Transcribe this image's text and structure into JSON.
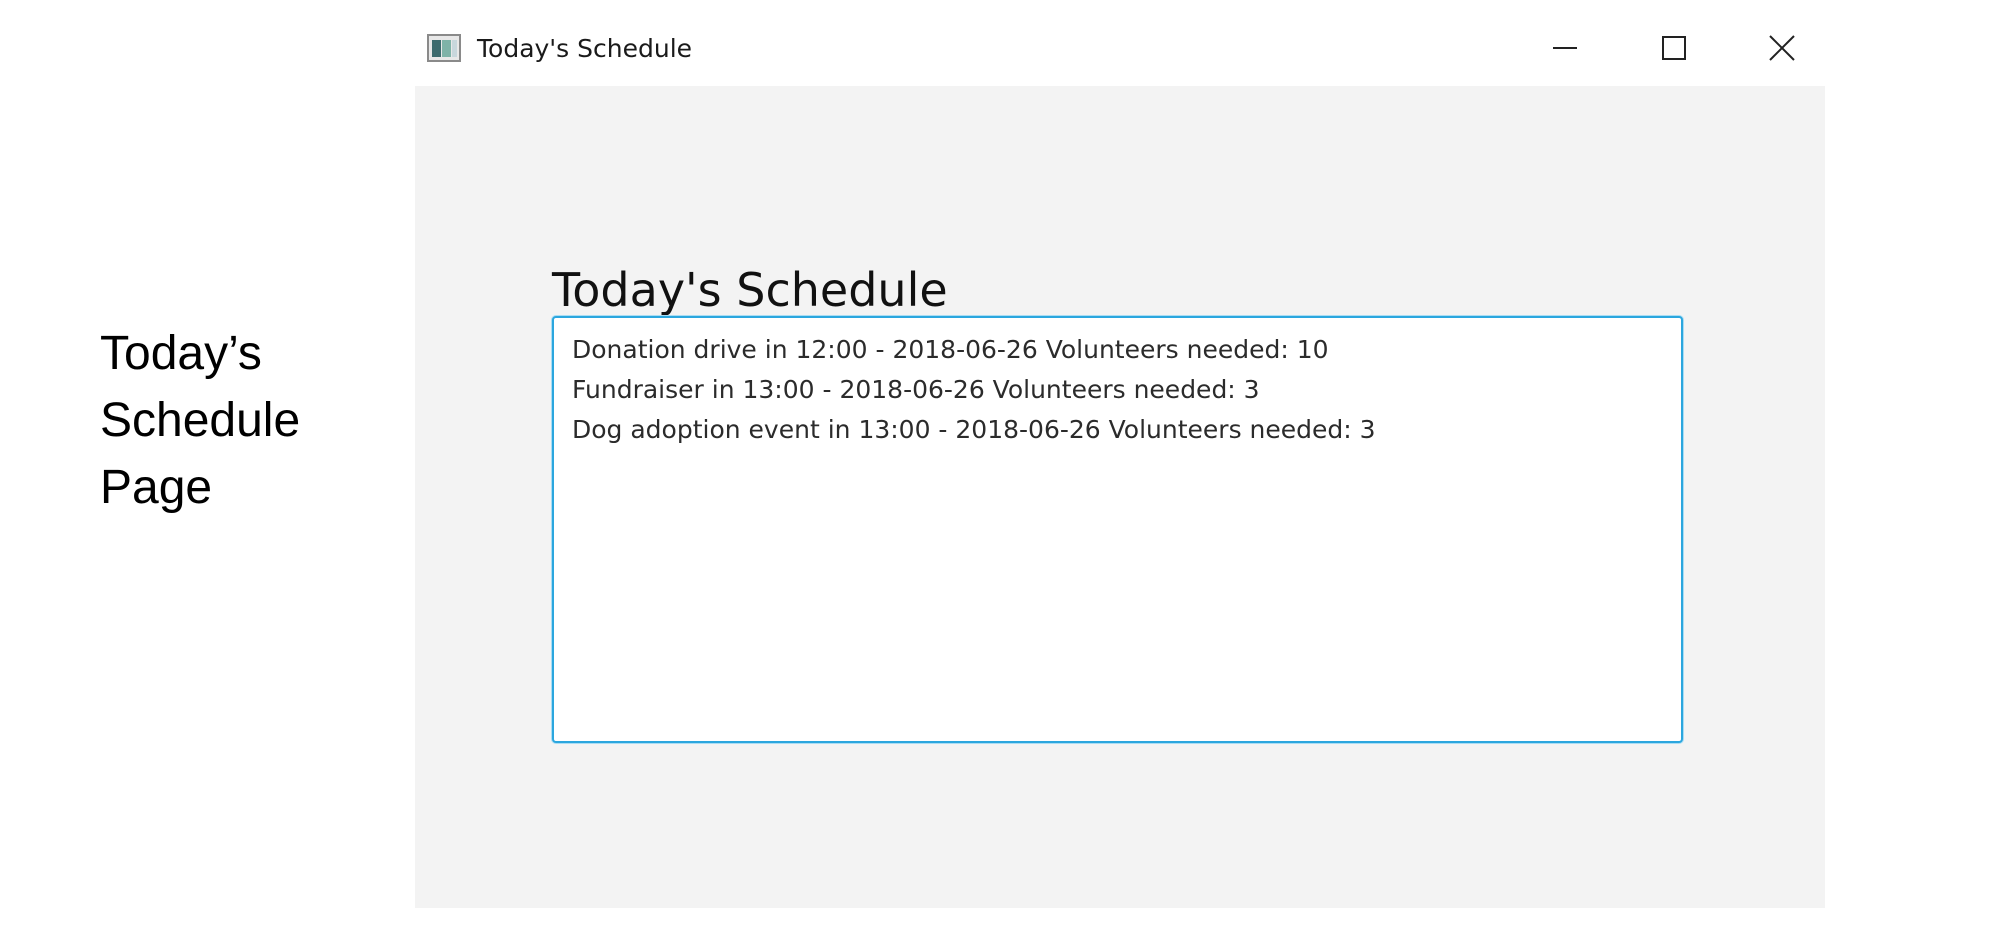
{
  "caption": {
    "lines": [
      "Today’s",
      "Schedule",
      "Page"
    ]
  },
  "window": {
    "title": "Today's Schedule",
    "icon": "app-window-icon",
    "controls": {
      "minimize_icon": "minimize-icon",
      "maximize_icon": "maximize-icon",
      "close_icon": "close-icon"
    }
  },
  "main": {
    "heading": "Today's Schedule",
    "list_items": [
      "Donation drive in 12:00 - 2018-06-26 Volunteers needed: 10",
      "Fundraiser in 13:00 - 2018-06-26 Volunteers needed: 3",
      "Dog adoption event in 13:00 - 2018-06-26 Volunteers needed: 3"
    ]
  },
  "colors": {
    "client_background": "#f3f3f3",
    "focus_border": "#2ba6de",
    "list_background": "#ffffff"
  }
}
